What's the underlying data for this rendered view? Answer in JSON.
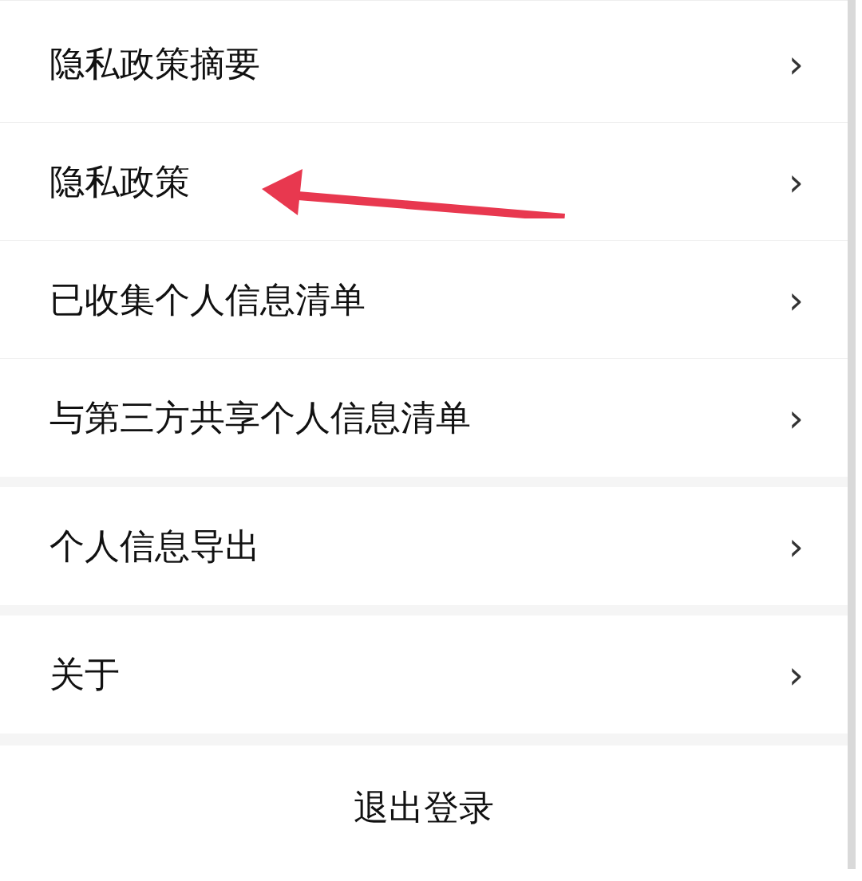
{
  "groups": [
    {
      "items": [
        {
          "label": "隐私政策摘要",
          "pointed": false
        },
        {
          "label": "隐私政策",
          "pointed": true
        },
        {
          "label": "已收集个人信息清单",
          "pointed": false
        },
        {
          "label": "与第三方共享个人信息清单",
          "pointed": false
        }
      ]
    },
    {
      "items": [
        {
          "label": "个人信息导出",
          "pointed": false
        }
      ]
    },
    {
      "items": [
        {
          "label": "关于",
          "pointed": false
        }
      ]
    }
  ],
  "chevron": "›",
  "logout_button": "退出登录"
}
